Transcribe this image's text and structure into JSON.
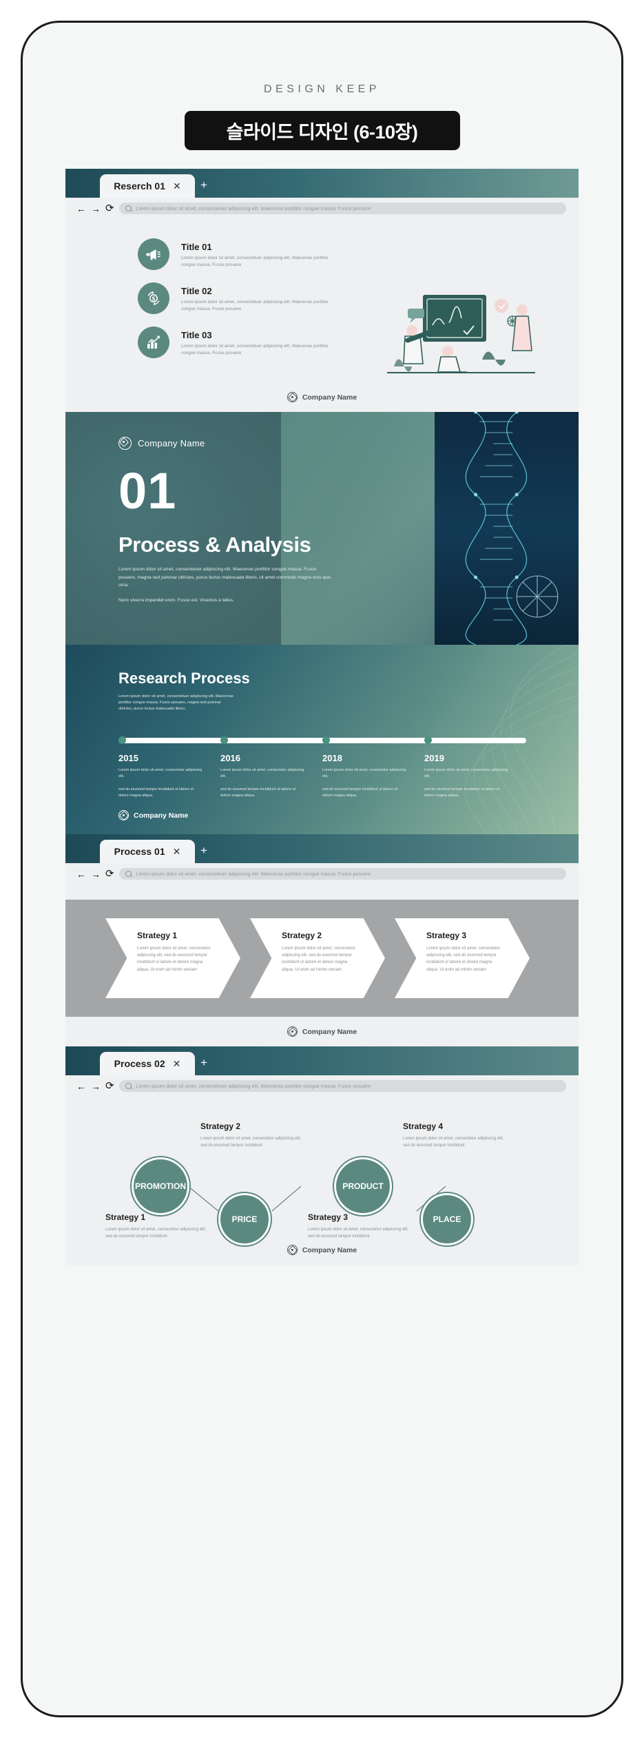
{
  "header": {
    "brand": "DESIGN KEEP",
    "chip_title": "슬라이드 디자인 (6-10장)"
  },
  "common": {
    "company_name": "Company Name",
    "url_placeholder": "Lorem ipsum dolor sit amet, consectetuer adipiscing elit. Maecenas porttitor congue massa. Fusce posuere",
    "tab_close": "✕",
    "tab_new": "+",
    "nav_back": "←",
    "nav_forward": "→",
    "nav_reload": "⟳"
  },
  "browsers": [
    {
      "tab_label": "Reserch 01"
    },
    {
      "tab_label": "Process 01"
    },
    {
      "tab_label": "Process 02"
    }
  ],
  "slide_titles": {
    "items": [
      {
        "icon": "megaphone-icon",
        "title": "Title 01",
        "body": "Lorem ipsum dolor sit amet, consectetuer adipiscing elit. Maecenas porttitor congue massa. Fusce posuere"
      },
      {
        "icon": "money-cycle-icon",
        "title": "Title 02",
        "body": "Lorem ipsum dolor sit amet, consectetuer adipiscing elit. Maecenas porttitor congue massa. Fusce posuere"
      },
      {
        "icon": "growth-chart-icon",
        "title": "Title 03",
        "body": "Lorem ipsum dolor sit amet, consectetuer adipiscing elit. Maecenas porttitor congue massa. Fusce posuere"
      }
    ]
  },
  "slide_hero": {
    "company_name": "Company Name",
    "number": "01",
    "title": "Process & Analysis",
    "body1": "Lorem ipsum dolor sit amet, consectetuer adipiscing elit. Maecenas porttitor congue massa. Fusce posuere, magna sed pulvinar ultricies, purus lectus malesuada libero, sit amet commodo magna eros quis urna.",
    "body2": "Nunc viverra imperdiet enim. Fusce est. Vivamus a tellus."
  },
  "slide_process": {
    "title": "Research Process",
    "subtitle": "Lorem ipsum dolor sit amet, consectetuer adipiscing elit. Maecenas porttitor congue massa. Fusce posuere, magna sed pulvinar ultricies, purus lectus malesuada libero.",
    "company_name": "Company Name",
    "milestones": [
      {
        "year": "2015",
        "text1": "Lorem ipsum dolor sit amet, consectetur adipiscing elit,",
        "text2": "sed do eiusmod tempor incididunt ut labore et dolore magna aliqua."
      },
      {
        "year": "2016",
        "text1": "Lorem ipsum dolor sit amet, consectetur adipiscing elit,",
        "text2": "sed do eiusmod tempor incididunt ut labore et dolore magna aliqua."
      },
      {
        "year": "2018",
        "text1": "Lorem ipsum dolor sit amet, consectetur adipiscing elit,",
        "text2": "sed do eiusmod tempor incididunt ut labore et dolore magna aliqua."
      },
      {
        "year": "2019",
        "text1": "Lorem ipsum dolor sit amet, consectetur adipiscing elit,",
        "text2": "sed do eiusmod tempor incididunt ut labore et dolore magna aliqua."
      }
    ]
  },
  "slide_strategy_chevrons": {
    "company_name": "Company Name",
    "items": [
      {
        "title": "Strategy 1",
        "body": "Lorem ipsum dolor sit amet, consectetur adipiscing elit, sed do eiusmod tempor incididunt ut labore et dolore magna aliqua. Ut enim ad minim veniam"
      },
      {
        "title": "Strategy 2",
        "body": "Lorem ipsum dolor sit amet, consectetur adipiscing elit, sed do eiusmod tempor incididunt ut labore et dolore magna aliqua. Ut enim ad minim veniam"
      },
      {
        "title": "Strategy 3",
        "body": "Lorem ipsum dolor sit amet, consectetur adipiscing elit, sed do eiusmod tempor incididunt ut labore et dolore magna aliqua. Ut enim ad minim veniam"
      }
    ]
  },
  "slide_strategy_circles": {
    "company_name": "Company Name",
    "circles": [
      {
        "label": "PROMOTION"
      },
      {
        "label": "PRICE"
      },
      {
        "label": "PRODUCT"
      },
      {
        "label": "PLACE"
      }
    ],
    "items": [
      {
        "title": "Strategy 1",
        "body": "Lorem ipsum dolor sit amet, consectetur adipiscing elit, sed do eiusmod tempor incididunt"
      },
      {
        "title": "Strategy 2",
        "body": "Lorem ipsum dolor sit amet, consectetur adipiscing elit, sed do eiusmod tempor incididunt"
      },
      {
        "title": "Strategy 3",
        "body": "Lorem ipsum dolor sit amet, consectetur adipiscing elit, sed do eiusmod tempor incididunt"
      },
      {
        "title": "Strategy 4",
        "body": "Lorem ipsum dolor sit amet, consectetur adipiscing elit, sed do eiusmod tempor incididunt"
      }
    ]
  },
  "colors": {
    "accent_teal": "#5b8980",
    "dark_teal": "#1f4b57",
    "page_bg": "#eff0f1",
    "chip_bg": "#111111",
    "grey_band": "#a3a5a6"
  }
}
